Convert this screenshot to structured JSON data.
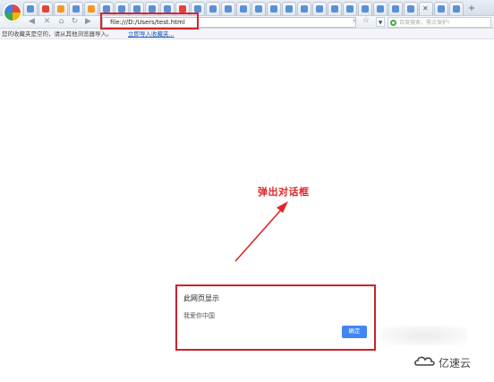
{
  "browser": {
    "logo_icon": "colorful-browser-logo-icon",
    "tabs": [
      {
        "icon": "blue"
      },
      {
        "icon": "red"
      },
      {
        "icon": "orange"
      },
      {
        "icon": "blue"
      },
      {
        "icon": "orange"
      },
      {
        "icon": "blue"
      },
      {
        "icon": "blue"
      },
      {
        "icon": "blue"
      },
      {
        "icon": "blue"
      },
      {
        "icon": "blue"
      },
      {
        "icon": "red"
      },
      {
        "icon": "blue"
      },
      {
        "icon": "blue"
      },
      {
        "icon": "blue"
      },
      {
        "icon": "blue"
      },
      {
        "icon": "blue"
      },
      {
        "icon": "blue"
      },
      {
        "icon": "blue"
      },
      {
        "icon": "blue"
      },
      {
        "icon": "blue"
      },
      {
        "icon": "blue"
      },
      {
        "icon": "blue"
      },
      {
        "icon": "blue"
      },
      {
        "icon": "blue"
      },
      {
        "icon": "blue"
      },
      {
        "icon": "blue"
      },
      {
        "icon": "close"
      },
      {
        "icon": "blue"
      },
      {
        "icon": "blue"
      }
    ],
    "address": "file:///D:/Users/test.html",
    "search_placeholder": "百度搜索，需点保护!"
  },
  "favorites_bar": {
    "message": "您的收藏夹是空的，请从其他浏览器导入。",
    "import_link": "立即导入收藏夹..."
  },
  "annotation": {
    "label": "弹出对话框",
    "color": "#e2262b"
  },
  "dialog": {
    "title": "此网页显示",
    "message": "我爱你中国",
    "ok_label": "确定",
    "button_color": "#4285f4"
  },
  "watermark": {
    "text": "亿速云"
  }
}
